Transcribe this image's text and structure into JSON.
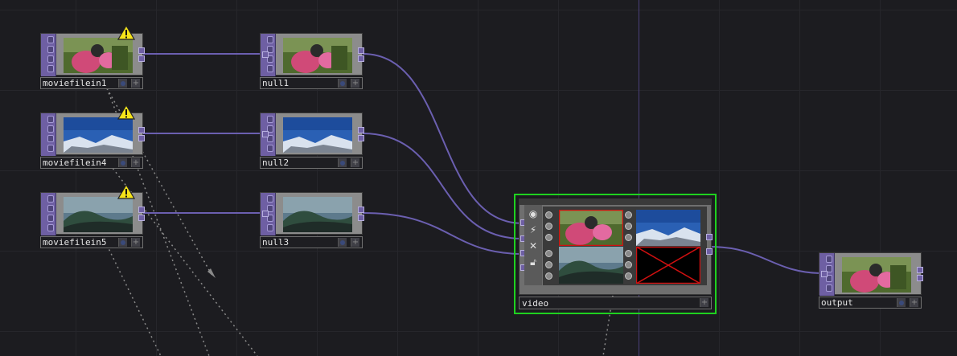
{
  "network": {
    "operators": [
      {
        "id": "moviefilein1",
        "label": "moviefilein1",
        "warning": true,
        "thumb": "girl"
      },
      {
        "id": "moviefilein4",
        "label": "moviefilein4",
        "warning": true,
        "thumb": "mountain"
      },
      {
        "id": "moviefilein5",
        "label": "moviefilein5",
        "warning": true,
        "thumb": "wave"
      },
      {
        "id": "null1",
        "label": "null1",
        "warning": false,
        "thumb": "girl"
      },
      {
        "id": "null2",
        "label": "null2",
        "warning": false,
        "thumb": "mountain"
      },
      {
        "id": "null3",
        "label": "null3",
        "warning": false,
        "thumb": "wave"
      },
      {
        "id": "output",
        "label": "output",
        "warning": false,
        "thumb": "girl"
      }
    ],
    "switch_op": {
      "label": "video",
      "inputs": 4,
      "filled_inputs": 3
    },
    "colors": {
      "wire": "#6b5fb0",
      "op_family_top": "#6e5fa3",
      "selected_border": "#1fd11f",
      "background": "#1c1c20",
      "empty_slot_cross": "#d01010"
    }
  }
}
